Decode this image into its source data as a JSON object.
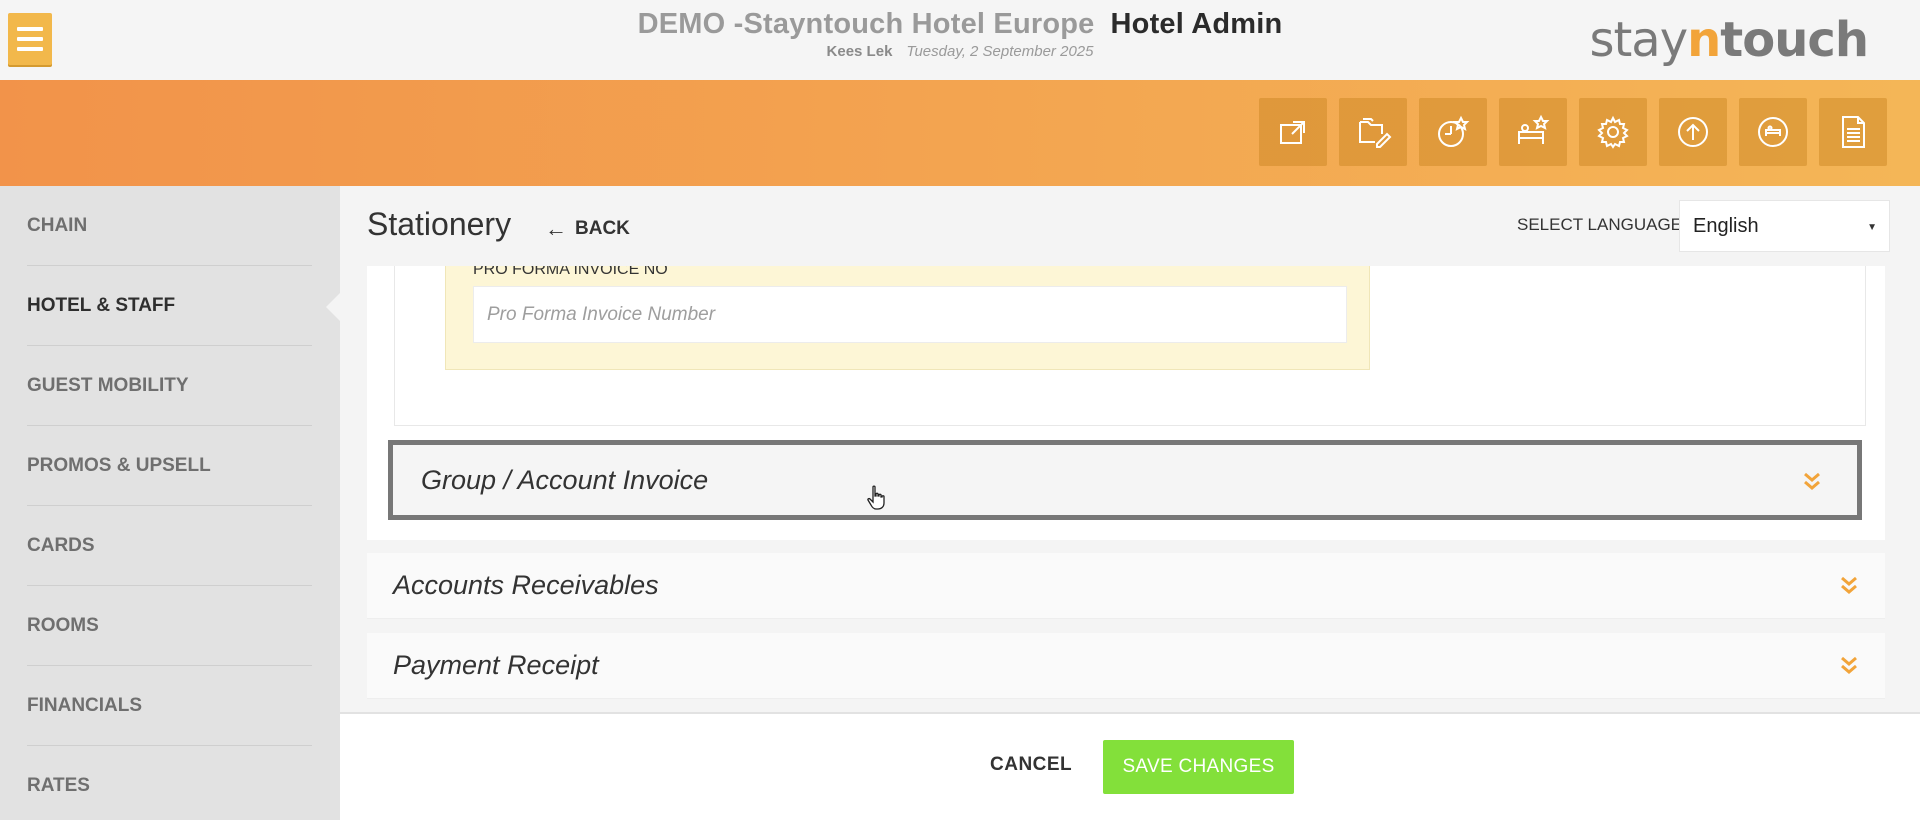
{
  "header": {
    "hotel_name": "DEMO -Stayntouch Hotel Europe",
    "app_name": "Hotel Admin",
    "user_name": "Kees Lek",
    "date": "Tuesday, 2 September 2025",
    "logo": {
      "part1": "stay",
      "part2": "n",
      "part3": "touch"
    }
  },
  "toolbar": {
    "icons": [
      "external-link-icon",
      "folder-edit-icon",
      "clock-star-icon",
      "bed-star-icon",
      "gear-icon",
      "upload-circle-icon",
      "clock-back-icon",
      "document-icon"
    ]
  },
  "sidebar": {
    "items": [
      {
        "label": "CHAIN",
        "active": false
      },
      {
        "label": "HOTEL & STAFF",
        "active": true
      },
      {
        "label": "GUEST MOBILITY",
        "active": false
      },
      {
        "label": "PROMOS & UPSELL",
        "active": false
      },
      {
        "label": "CARDS",
        "active": false
      },
      {
        "label": "ROOMS",
        "active": false
      },
      {
        "label": "FINANCIALS",
        "active": false
      },
      {
        "label": "RATES",
        "active": false
      }
    ]
  },
  "main": {
    "title": "Stationery",
    "back_label": "BACK",
    "language_label": "SELECT LANGUAGE",
    "language_value": "English",
    "pro_forma": {
      "label": "PRO FORMA INVOICE NO",
      "placeholder": "Pro Forma Invoice Number",
      "value": ""
    },
    "sections": [
      {
        "title": "Group / Account Invoice"
      },
      {
        "title": "Accounts Receivables"
      },
      {
        "title": "Payment Receipt"
      }
    ]
  },
  "footer": {
    "cancel_label": "CANCEL",
    "save_label": "SAVE CHANGES"
  },
  "colors": {
    "accent_orange": "#f2a43a",
    "save_green": "#83e03a",
    "menu_yellow": "#f2b84b"
  }
}
